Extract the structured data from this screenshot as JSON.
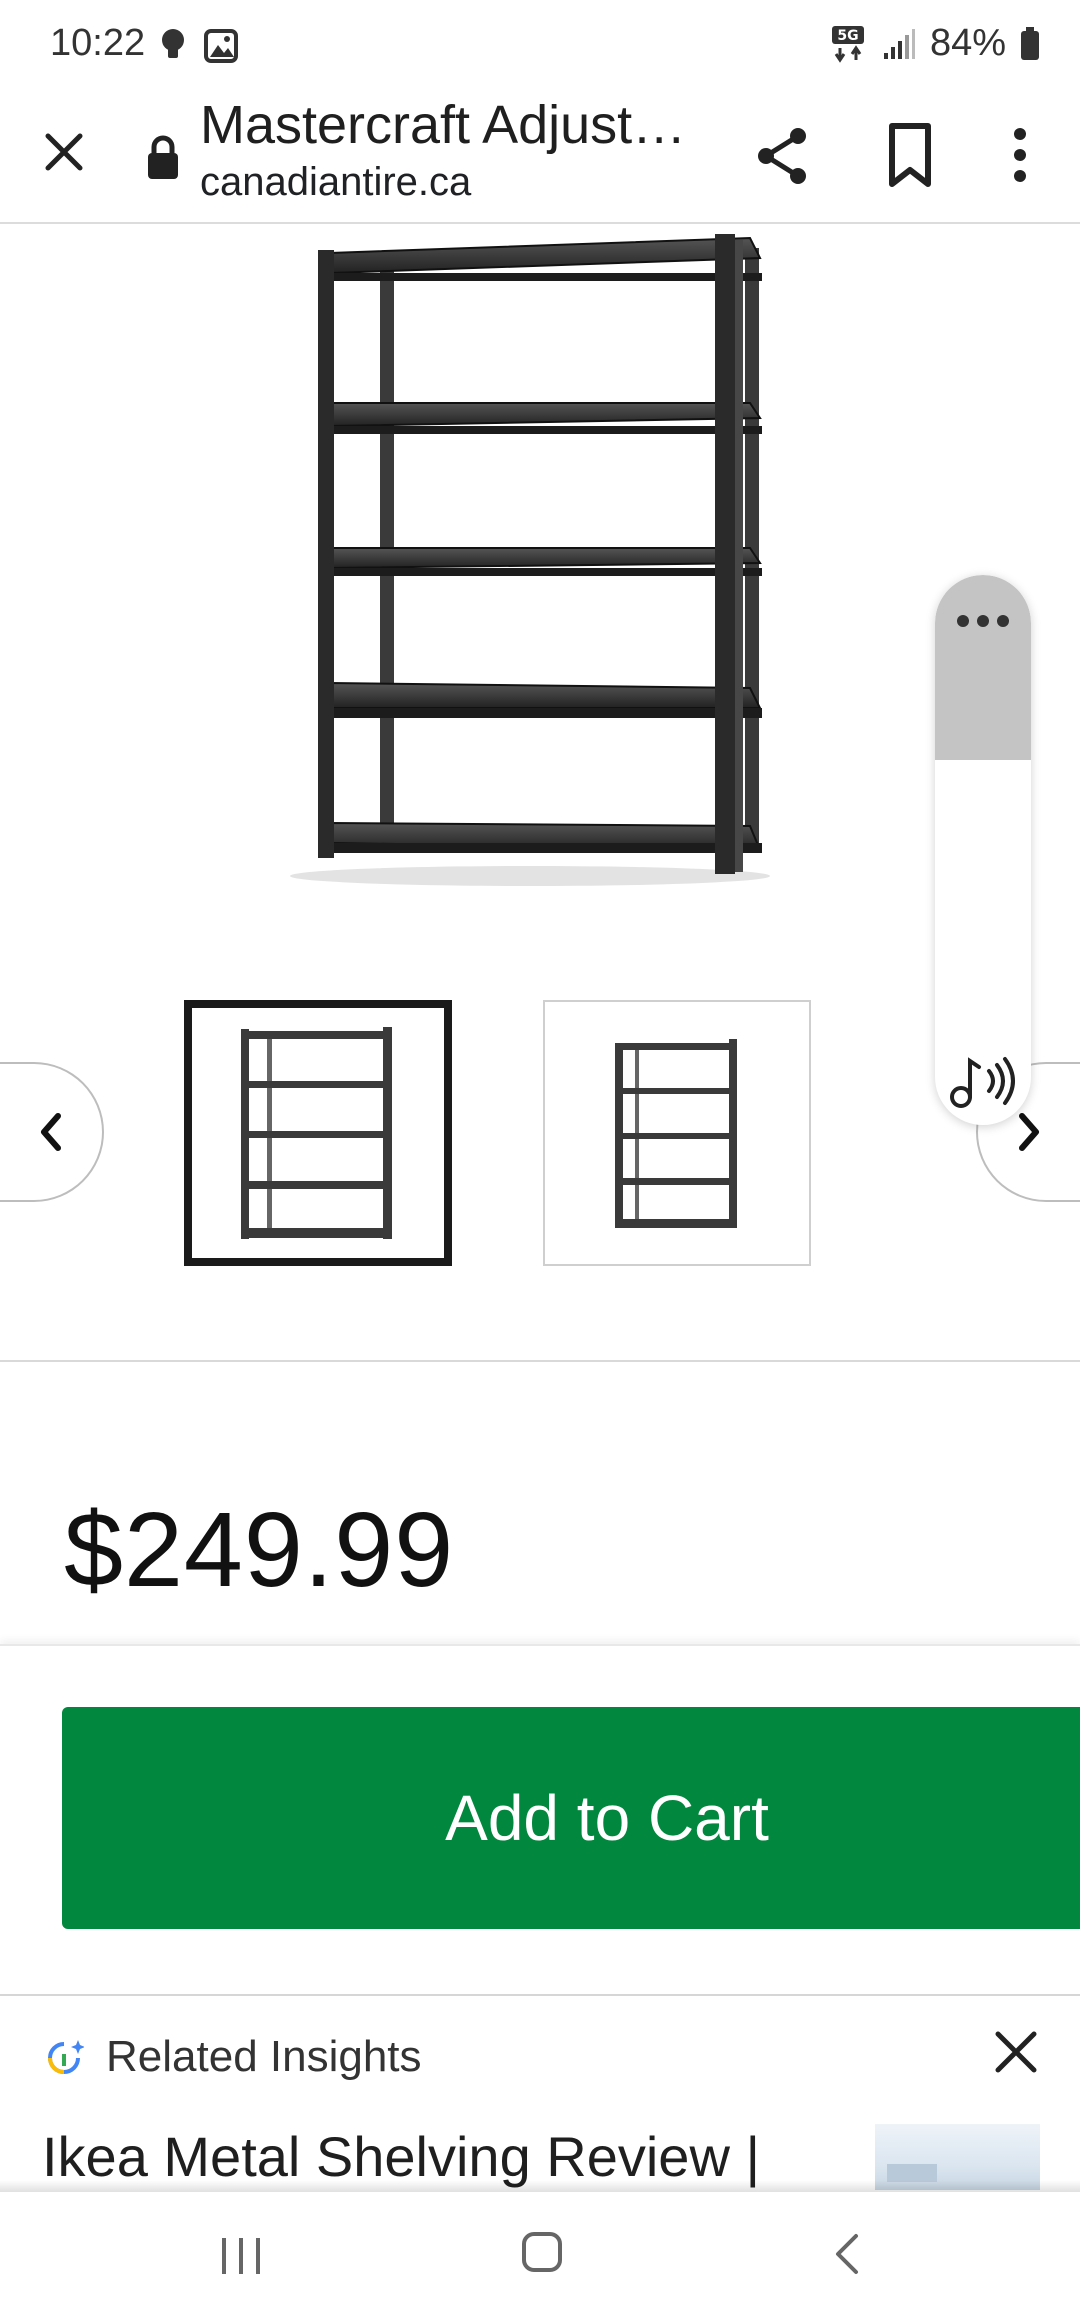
{
  "status_bar": {
    "time": "10:22",
    "network": "5G",
    "battery": "84%"
  },
  "browser": {
    "page_title": "Mastercraft Adjust…",
    "url": "canadiantire.ca",
    "icons": [
      "close-icon",
      "lock-icon",
      "share-icon",
      "bookmark-icon",
      "more-vert-icon"
    ]
  },
  "product": {
    "image": "metal-shelving-unit",
    "thumbnails": [
      {
        "name": "shelf-front",
        "selected": true
      },
      {
        "name": "shelf-angle",
        "selected": false
      }
    ],
    "price": "$249.99",
    "add_to_cart_label": "Add to Cart",
    "accent_color": "#02873e"
  },
  "read_aloud": {
    "icons": [
      "more-horiz-icon",
      "audio-icon"
    ]
  },
  "insights": {
    "title": "Related Insights",
    "headline": "Ikea Metal Shelving Review |"
  }
}
